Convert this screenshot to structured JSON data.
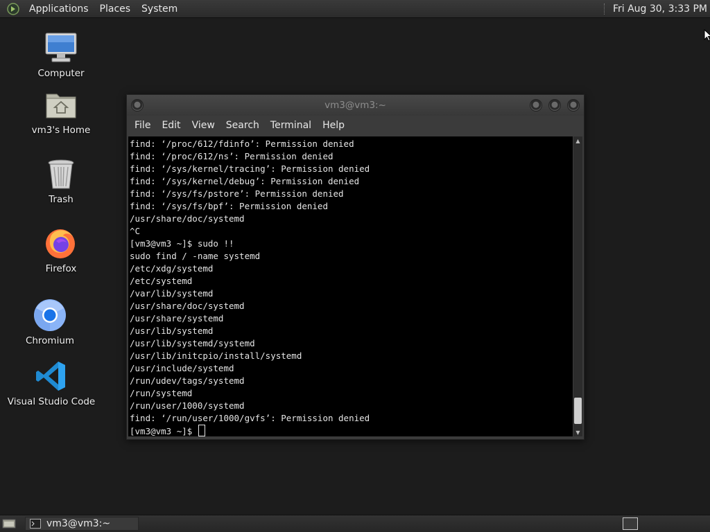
{
  "top_panel": {
    "menus": [
      "Applications",
      "Places",
      "System"
    ],
    "clock": "Fri Aug 30,  3:33 PM"
  },
  "desktop": {
    "icons": [
      {
        "label": "Computer",
        "icon": "computer-icon"
      },
      {
        "label": "vm3's Home",
        "icon": "home-folder-icon"
      },
      {
        "label": "Trash",
        "icon": "trash-icon"
      },
      {
        "label": "Firefox",
        "icon": "firefox-icon"
      },
      {
        "label": "Chromium",
        "icon": "chromium-icon"
      },
      {
        "label": "Visual Studio Code",
        "icon": "vscode-icon"
      }
    ]
  },
  "terminal": {
    "title": "vm3@vm3:~",
    "menus": [
      "File",
      "Edit",
      "View",
      "Search",
      "Terminal",
      "Help"
    ],
    "lines": [
      "find: ‘/proc/612/fdinfo’: Permission denied",
      "find: ‘/proc/612/ns’: Permission denied",
      "find: ‘/sys/kernel/tracing’: Permission denied",
      "find: ‘/sys/kernel/debug’: Permission denied",
      "find: ‘/sys/fs/pstore’: Permission denied",
      "find: ‘/sys/fs/bpf’: Permission denied",
      "/usr/share/doc/systemd",
      "^C",
      "[vm3@vm3 ~]$ sudo !!",
      "sudo find / -name systemd",
      "/etc/xdg/systemd",
      "/etc/systemd",
      "/var/lib/systemd",
      "/usr/share/doc/systemd",
      "/usr/share/systemd",
      "/usr/lib/systemd",
      "/usr/lib/systemd/systemd",
      "/usr/lib/initcpio/install/systemd",
      "/usr/include/systemd",
      "/run/udev/tags/systemd",
      "/run/systemd",
      "/run/user/1000/systemd",
      "find: ‘/run/user/1000/gvfs’: Permission denied"
    ],
    "prompt": "[vm3@vm3 ~]$ "
  },
  "taskbar": {
    "window_label": "vm3@vm3:~"
  }
}
